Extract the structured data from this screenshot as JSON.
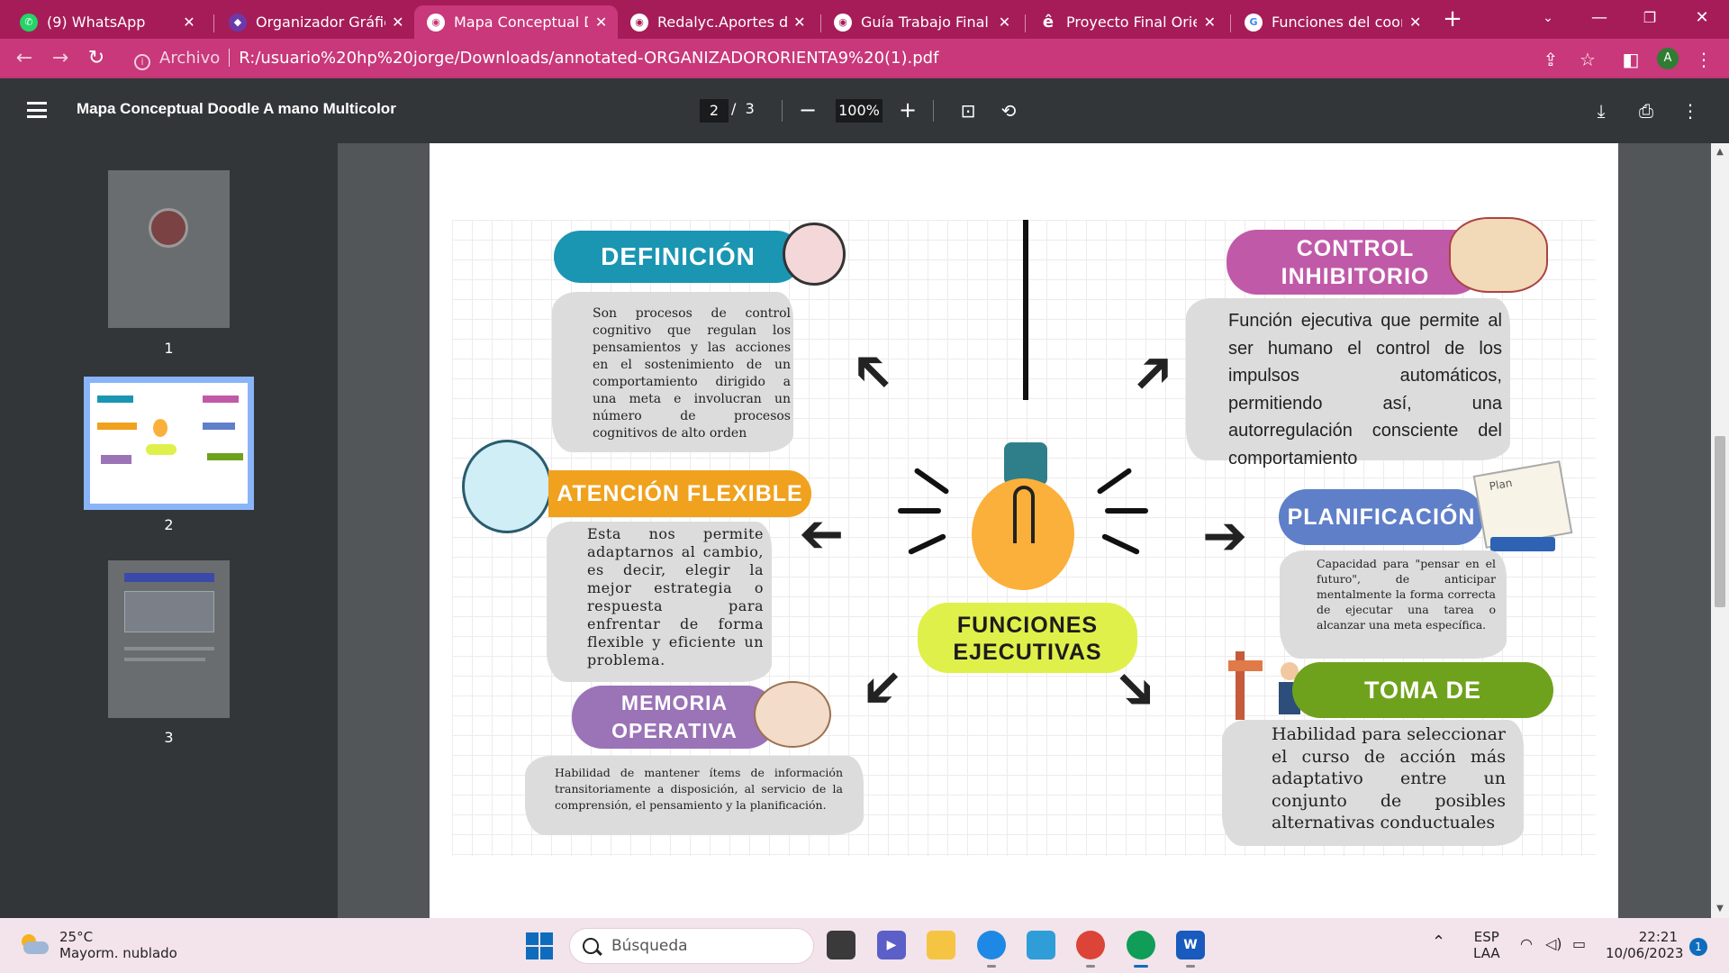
{
  "browser": {
    "tabs": [
      {
        "label": "(9) WhatsApp",
        "icon": "whatsapp-icon",
        "active": false
      },
      {
        "label": "Organizador Gráfico y",
        "icon": "app-icon",
        "active": false
      },
      {
        "label": "Mapa Conceptual Doo",
        "icon": "globe-icon",
        "active": true
      },
      {
        "label": "Redalyc.Aportes de la",
        "icon": "globe-icon",
        "active": false
      },
      {
        "label": "Guía Trabajo Final - O",
        "icon": "globe-icon",
        "active": false
      },
      {
        "label": "Proyecto Final Orient",
        "icon": "e-icon",
        "active": false
      },
      {
        "label": "Funciones del coordin",
        "icon": "google-icon",
        "active": false
      }
    ],
    "new_tab": "+",
    "address": {
      "scheme_label": "Archivo",
      "url": "R:/usuario%20hp%20jorge/Downloads/annotated-ORGANIZADORORIENTA9%20(1).pdf"
    },
    "profile_initial": "A"
  },
  "pdf": {
    "title": "Mapa Conceptual Doodle A mano Multicolor",
    "current_page": "2",
    "page_sep": "/",
    "total_pages": "3",
    "zoom": "100%",
    "thumbnails": [
      "1",
      "2",
      "3"
    ]
  },
  "concept_map": {
    "center": "FUNCIONES\nEJECUTIVAS",
    "definicion": {
      "title": "DEFINICIÓN",
      "text": "Son procesos de control cognitivo que regulan los pensamientos y las acciones en el sostenimiento de un comportamiento dirigido a una meta e involucran un número de procesos cognitivos de alto orden"
    },
    "atencion": {
      "title": "ATENCIÓN FLEXIBLE",
      "text": "Esta nos permite adaptarnos al cambio, es decir, elegir la mejor estrategia o respuesta para enfrentar de forma flexible y eficiente un problema."
    },
    "memoria": {
      "title": "MEMORIA\nOPERATIVA",
      "text": "Habilidad de mantener ítems de información transitoriamente a disposición, al servicio de la comprensión, el pensamiento y la planificación."
    },
    "control": {
      "title": "CONTROL\nINHIBITORIO",
      "text": "Función ejecutiva que permite al ser humano el control de los impulsos automáticos, permitiendo así, una autorregulación consciente del comportamiento"
    },
    "planificacion": {
      "title": "PLANIFICACIÓN",
      "text": "Capacidad para \"pensar en el futuro\", de anticipar mentalmente la forma correcta de ejecutar una tarea o alcanzar una meta específica.",
      "note_label": "Plan"
    },
    "toma": {
      "title": "TOMA DE DECISIONES",
      "text": "Habilidad para seleccionar el curso de acción más adaptativo entre un conjunto de posibles alternativas conductuales"
    },
    "colors": {
      "definicion": "#1a96b3",
      "atencion": "#f0a11e",
      "memoria": "#9b73b7",
      "control": "#c05aa8",
      "planificacion": "#5f7fc9",
      "toma": "#6ea21c",
      "center": "#dff04b",
      "bulb": "#fbb03b"
    }
  },
  "taskbar": {
    "temperature": "25°C",
    "weather": "Mayorm. nublado",
    "search_placeholder": "Búsqueda",
    "language": "ESP",
    "layout": "LAA",
    "time": "22:21",
    "date": "10/06/2023",
    "notifications": "1"
  }
}
